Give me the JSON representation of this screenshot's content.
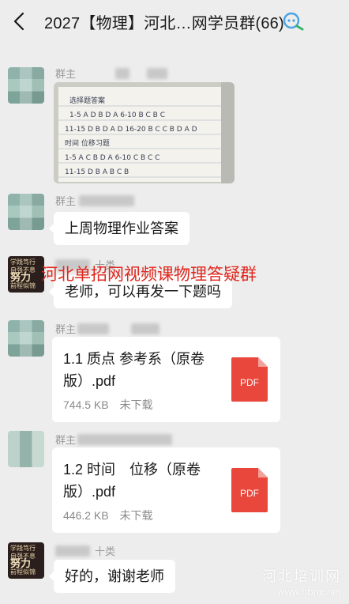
{
  "header": {
    "title": "2027【物理】河北…网学员群(66)",
    "back_icon": "chevron-left-icon",
    "badge_icon": "group-chat-icon"
  },
  "messages": [
    {
      "sender_label": "群主",
      "type": "image",
      "image_text": [
        "选择题答案",
        "1-5  A D B D A     6-10  B C B C",
        "11-15  D B D A D     16-20  B C C B D  A D",
        "时间 位移习题",
        "1-5  A C B D A     6-10  C B C C",
        "11-15  D B A B C          B"
      ]
    },
    {
      "sender_label": "群主",
      "type": "text",
      "text": "上周物理作业答案"
    },
    {
      "sender_label": "十类",
      "type": "text",
      "text": "老师，可以再发一下题吗"
    },
    {
      "sender_label": "群主",
      "type": "file",
      "file_name": "1.1 质点 参考系（原卷版）.pdf",
      "size": "744.5 KB",
      "status": "未下载",
      "icon": "pdf-icon",
      "icon_text": "PDF"
    },
    {
      "sender_label": "群主",
      "type": "file",
      "file_name": "1.2 时间　位移（原卷版）.pdf",
      "size": "446.2 KB",
      "status": "未下载",
      "icon": "pdf-icon",
      "icon_text": "PDF"
    },
    {
      "sender_label": "十类",
      "type": "text",
      "text": "好的，谢谢老师"
    }
  ],
  "avatar_poster": {
    "line1": "学践笃行 自强不息",
    "big": "努力",
    "line2": "前程似锦"
  },
  "watermark": "河北单招网视频课物理答疑群",
  "corner_watermark": {
    "line1": "河北培训网",
    "line2": "www.hbpx.net"
  },
  "colors": {
    "background": "#ededed",
    "bubble": "#ffffff",
    "pdf_red": "#e9473c",
    "watermark_red": "#e0271e"
  }
}
